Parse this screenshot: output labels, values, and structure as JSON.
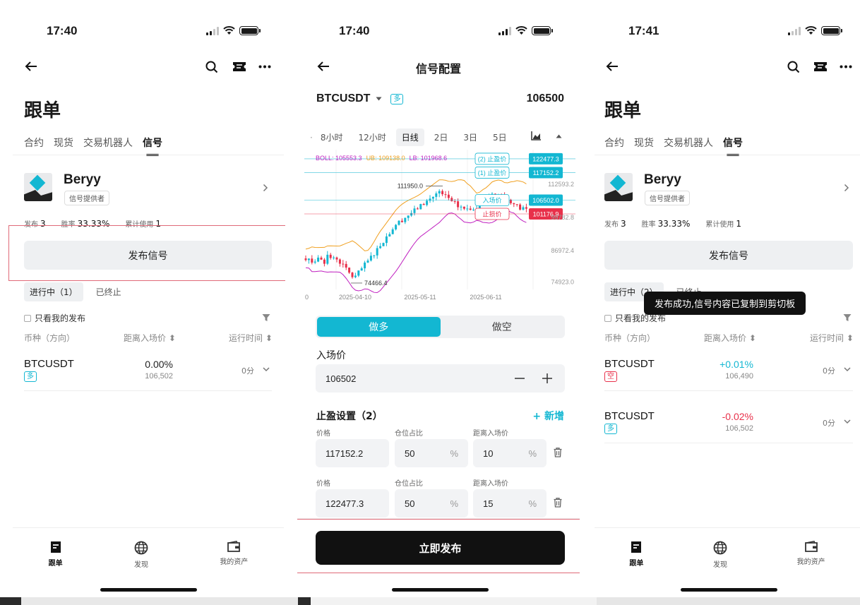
{
  "screen1": {
    "time": "17:40",
    "title": "跟单",
    "tabs": [
      "合约",
      "现货",
      "交易机器人",
      "信号"
    ],
    "provider": {
      "name": "Beryy",
      "badge": "信号提供者"
    },
    "stats": [
      {
        "label": "发布",
        "value": "3"
      },
      {
        "label": "胜率",
        "value": "33.33%"
      },
      {
        "label": "累计使用",
        "value": "1"
      }
    ],
    "publish_label": "发布信号",
    "seg_running": "进行中（1）",
    "seg_ended": "已终止",
    "only_mine": "只看我的发布",
    "col_symbol": "币种（方向）",
    "col_distance": "距离入场价 ⬍",
    "col_runtime": "运行时间 ⬍",
    "rows": [
      {
        "symbol": "BTCUSDT",
        "dir": "多",
        "pct": "0.00%",
        "price": "106,502",
        "runtime": "0分"
      }
    ],
    "nav": [
      "跟单",
      "发现",
      "我的资产"
    ]
  },
  "screen2": {
    "time": "17:40",
    "title": "信号配置",
    "symbol": "BTCUSDT",
    "dir_tag": "多",
    "price": "106500",
    "timeframes": [
      "8小时",
      "12小时",
      "日线",
      "2日",
      "3日",
      "5日"
    ],
    "boll_labels": {
      "boll": "BOLL: 105553.3",
      "ub": "UB: 109138.0",
      "lb": "LB: 101968.6"
    },
    "chart_data": {
      "type": "candlestick",
      "x_ticks": [
        "2025-04-10",
        "2025-05-11",
        "2025-06-11"
      ],
      "y_ticks": [
        "112593.2",
        "99782.8",
        "86972.4",
        "74923.0"
      ],
      "annotations": {
        "high": "111950.0",
        "low": "74466.4"
      },
      "lines": [
        {
          "label": "(2) 止盈价",
          "value": "122477.3"
        },
        {
          "label": "(1) 止盈价",
          "value": "117152.2"
        },
        {
          "label": "入场价",
          "value": "106502.0"
        },
        {
          "label": "止损价",
          "value": "101176.9"
        }
      ]
    },
    "long_label": "做多",
    "short_label": "做空",
    "entry_label": "入场价",
    "entry_value": "106502",
    "tp_title": "止盈设置（2）",
    "add_label": "+ 新增",
    "field_price": "价格",
    "field_ratio": "仓位占比",
    "field_dist": "距离入场价",
    "percent": "%",
    "tp_rows": [
      {
        "price": "117152.2",
        "ratio": "50",
        "dist": "10"
      },
      {
        "price": "122477.3",
        "ratio": "50",
        "dist": "15"
      }
    ],
    "publish_now": "立即发布"
  },
  "screen3": {
    "time": "17:41",
    "title": "跟单",
    "tabs": [
      "合约",
      "现货",
      "交易机器人",
      "信号"
    ],
    "provider": {
      "name": "Beryy",
      "badge": "信号提供者"
    },
    "stats": [
      {
        "label": "发布",
        "value": "3"
      },
      {
        "label": "胜率",
        "value": "33.33%"
      },
      {
        "label": "累计使用",
        "value": "1"
      }
    ],
    "publish_label": "发布信号",
    "seg_running": "进行中（2）",
    "seg_ended": "已终止",
    "only_mine": "只看我的发布",
    "col_symbol": "币种（方向）",
    "col_distance": "距离入场价 ⬍",
    "col_runtime": "运行时间 ⬍",
    "toast": "发布成功,信号内容已复制到剪切板",
    "rows": [
      {
        "symbol": "BTCUSDT",
        "dir": "空",
        "pct": "+0.01%",
        "price": "106,490",
        "runtime": "0分"
      },
      {
        "symbol": "BTCUSDT",
        "dir": "多",
        "pct": "-0.02%",
        "price": "106,502",
        "runtime": "0分"
      }
    ],
    "nav": [
      "跟单",
      "发现",
      "我的资产"
    ]
  },
  "colors": {
    "accent": "#13b7d2",
    "danger": "#e8304a",
    "up": "#13b7d2",
    "down": "#e8304a",
    "ub": "#f0a020",
    "lb": "#c020c0"
  }
}
